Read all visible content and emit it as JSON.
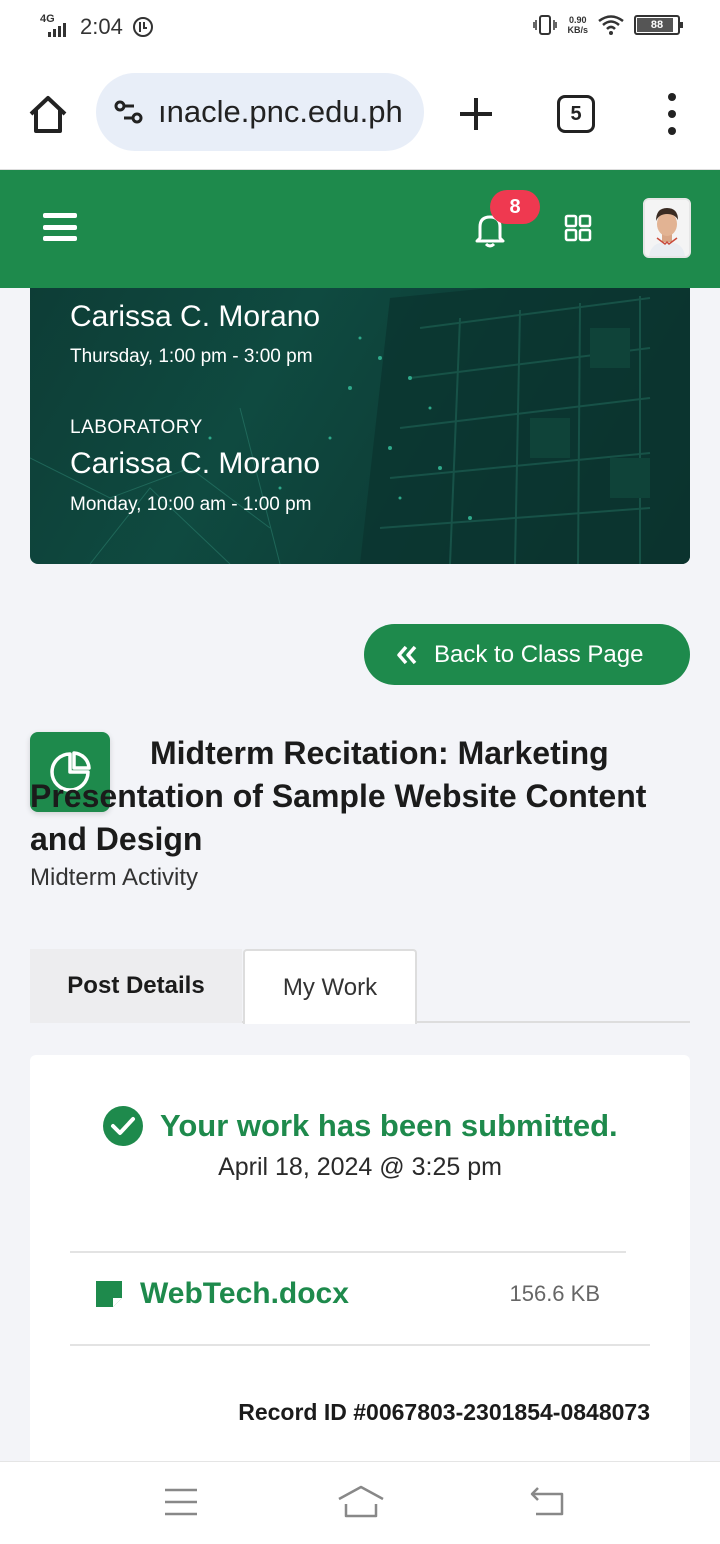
{
  "status_bar": {
    "time": "2:04",
    "network": "4G",
    "speed_value": "0.90",
    "speed_unit": "KB/s",
    "battery": "88"
  },
  "browser": {
    "url": "ınacle.pnc.edu.ph",
    "tab_count": "5"
  },
  "app_header": {
    "notification_count": "8",
    "brand_color": "#1e8a4c"
  },
  "banner": {
    "lecture_instructor": "Carissa C. Morano",
    "lecture_schedule": "Thursday, 1:00 pm - 3:00 pm",
    "lab_label": "LABORATORY",
    "lab_instructor": "Carissa C. Morano",
    "lab_schedule": "Monday, 10:00 am - 1:00 pm"
  },
  "back_button": {
    "label": "Back to Class Page"
  },
  "post": {
    "title": "Midterm Recitation: Marketing Presentation of Sample Website Content and Design",
    "subtitle": "Midterm Activity"
  },
  "tabs": [
    {
      "label": "Post Details",
      "active": false
    },
    {
      "label": "My Work",
      "active": true
    }
  ],
  "submission": {
    "status": "Your work has been submitted.",
    "date": "April 18, 2024 @ 3:25 pm",
    "file_name": "WebTech.docx",
    "file_size": "156.6 KB",
    "record_id": "Record ID #0067803-2301854-0848073"
  }
}
